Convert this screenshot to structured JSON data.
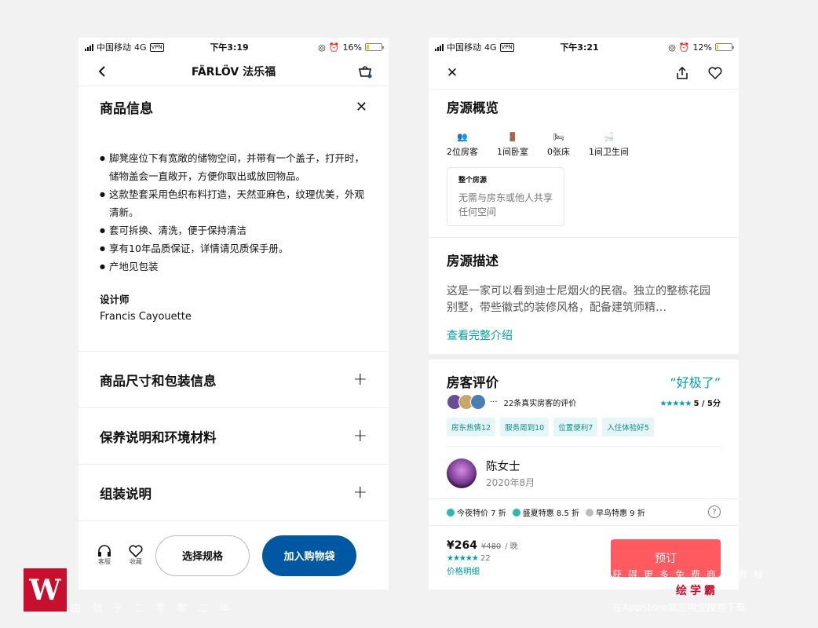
{
  "left": {
    "status": {
      "carrier": "中国移动",
      "network": "4G",
      "vpn": "VPN",
      "time": "下午3:19",
      "battery_text": "16%",
      "battery_level": 0.16
    },
    "nav": {
      "title": "FÄRLÖV 法乐福"
    },
    "section": {
      "title": "商品信息"
    },
    "bullets": [
      "脚凳座位下有宽敞的储物空间，并带有一个盖子，打开时，储物盖会一直敞开，方便你取出或放回物品。",
      "这款垫套采用色织布料打造，天然亚麻色，纹理优美，外观清新。",
      "套可拆换、清洗，便于保持清洁",
      "享有10年品质保证，详情请见质保手册。",
      "产地见包装"
    ],
    "designer_label": "设计师",
    "designer_name": "Francis Cayouette",
    "accordions": [
      "商品尺寸和包装信息",
      "保养说明和环境材料",
      "组装说明"
    ],
    "bottom": {
      "headset_label": "客服",
      "fav_label": "收藏",
      "spec_button": "选择规格",
      "cart_button": "加入购物袋"
    }
  },
  "right": {
    "status": {
      "carrier": "中国移动",
      "network": "4G",
      "vpn": "VPN",
      "time": "下午3:21",
      "battery_text": "12%",
      "battery_level": 0.12
    },
    "overview": {
      "title": "房源概览",
      "stats": [
        "2位房客",
        "1间卧室",
        "0张床",
        "1间卫生间"
      ],
      "card_title": "整个房源",
      "card_desc": "无需与房东或他人共享任何空间"
    },
    "description": {
      "title": "房源描述",
      "text": "这是一家可以看到迪士尼烟火的民宿。独立的整栋花园别墅，带些徽式的装修风格，配备建筑师精…",
      "link": "查看完整介绍"
    },
    "reviews": {
      "title": "房客评价",
      "rating_word": "“好极了”",
      "more": "···",
      "count_text": "22条真实房客的评价",
      "stars": "★★★★★",
      "score": "5 / 5分",
      "tags": [
        "房东热情12",
        "服务周到10",
        "位置便利7",
        "入住体验好5"
      ],
      "reviewer_name": "陈女士",
      "reviewer_date": "2020年8月"
    },
    "promos": [
      "今夜特价 7 折",
      "盛夏特惠 8.5 折",
      "早鸟特惠 9 折"
    ],
    "help": "?",
    "bottom": {
      "price": "¥264",
      "orig_price": "¥480",
      "per": "/ 晚",
      "stars": "★★★★★",
      "review_count": "22",
      "price_note": "价格明细",
      "book_button": "预订"
    }
  },
  "watermark": {
    "logo": "W",
    "left_text": "由创于二零零二年",
    "right_line1": "获得更多免费商品教程",
    "right_brand": "绘学霸",
    "right_line3": "在AppStore或应用宝搜索下载"
  },
  "colors": {
    "ikea_blue": "#0058a3",
    "teal": "#00a1a1",
    "coral": "#ff5a5f",
    "watermark_red": "#c8102e"
  }
}
